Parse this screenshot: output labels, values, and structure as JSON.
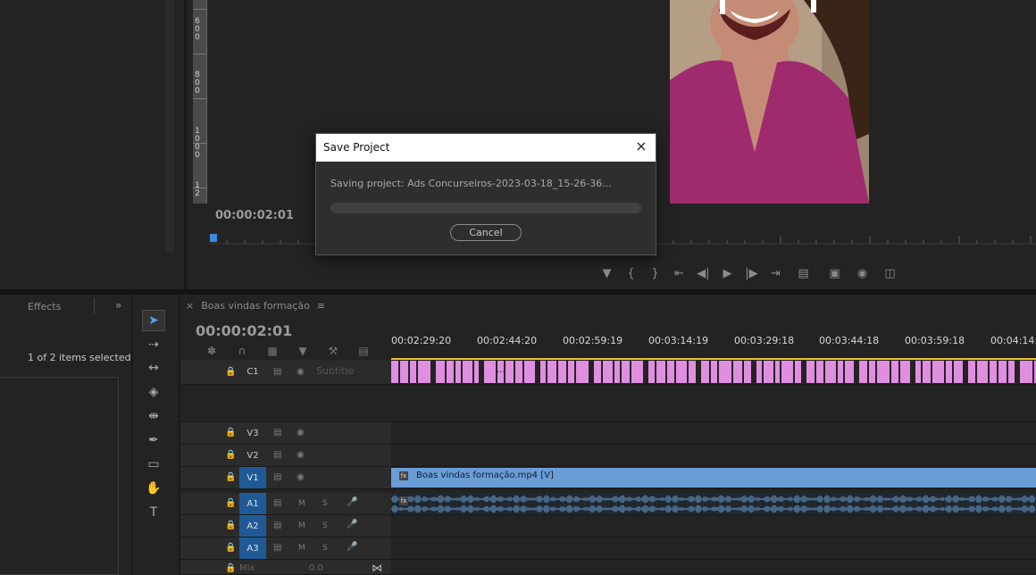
{
  "program_monitor": {
    "timecode": "00:00:02:01",
    "ruler_digits": [
      {
        "v": "6"
      },
      {
        "v": "0"
      },
      {
        "v": "0"
      },
      {
        "v": "8"
      },
      {
        "v": "0"
      },
      {
        "v": "0"
      },
      {
        "v": "1"
      },
      {
        "v": "0"
      },
      {
        "v": "0"
      },
      {
        "v": "0"
      },
      {
        "v": "1"
      },
      {
        "v": "2"
      }
    ]
  },
  "effects_panel": {
    "tab_label": "Effects",
    "overflow_label": "»",
    "selection_status": "1 of 2 items selected"
  },
  "timeline": {
    "sequence_name": "Boas vindas formação",
    "timecode": "00:00:02:01",
    "ruler_timecodes": [
      "00:02:29:20",
      "00:02:44:20",
      "00:02:59:19",
      "00:03:14:19",
      "00:03:29:18",
      "00:03:44:18",
      "00:03:59:18",
      "00:04:14:1"
    ],
    "tracks": {
      "c1": {
        "name": "C1",
        "label": "Subtitle",
        "clip_marker": "..."
      },
      "v3": {
        "name": "V3"
      },
      "v2": {
        "name": "V2"
      },
      "v1": {
        "name": "V1",
        "clip_label": "Boas vindas formação.mp4 [V]"
      },
      "a1": {
        "name": "A1",
        "m": "M",
        "s": "S"
      },
      "a2": {
        "name": "A2",
        "m": "M",
        "s": "S"
      },
      "a3": {
        "name": "A3",
        "m": "M",
        "s": "S"
      },
      "mix": {
        "name": "Mix",
        "value": "0.0"
      }
    },
    "colors": {
      "subtitle_clip": "#e08ee0",
      "video_clip": "#6a9dd6",
      "target_track": "#1f5a96",
      "in_out_bar": "#e8c42a"
    }
  },
  "dialog": {
    "title": "Save Project",
    "message": "Saving project: Ads Concurseiros-2023-03-18_15-26-36...",
    "progress": 0,
    "cancel_label": "Cancel"
  },
  "icons": {
    "close": "close-icon",
    "play": "play-icon",
    "selection_tool": "arrow-icon"
  }
}
